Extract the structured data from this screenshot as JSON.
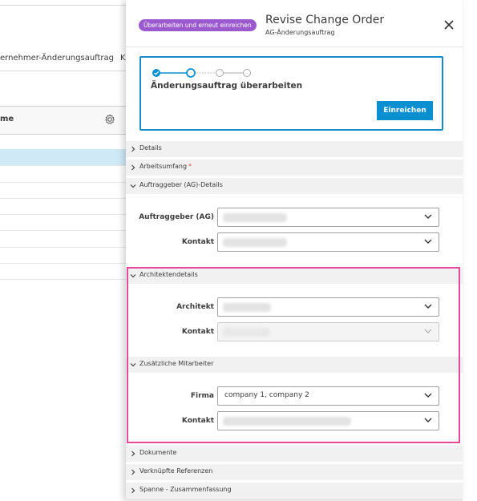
{
  "background": {
    "tab_label": "ernehmer-Änderungsauftrag",
    "tab_label2": "K",
    "column_header": "me",
    "icons": {
      "settings": "gear-icon"
    }
  },
  "panel": {
    "status": "Überarbeiten und erneut einreichen",
    "title": "Revise Change Order",
    "subtitle": "AG-Änderungsauftrag",
    "icons": {
      "close": "close-icon"
    }
  },
  "stepper": {
    "title": "Änderungsauftrag überarbeiten",
    "steps_completed": 1,
    "current_step": 2,
    "total_steps": 4,
    "submit_label": "Einreichen"
  },
  "sections": {
    "details": "Details",
    "scope": "Arbeitsumfang",
    "scope_required": "*",
    "client": "Auftraggeber (AG)-Details",
    "architect": "Architektendetails",
    "additional": "Zusätzliche Mitarbeiter",
    "documents": "Dokumente",
    "refs": "Verknüpfte Referenzen",
    "summary": "Spanne - Zusammenfassung"
  },
  "fields": {
    "client_label": "Auftraggeber (AG)",
    "client_contact_label": "Kontakt",
    "architect_label": "Architekt",
    "architect_contact_label": "Kontakt",
    "company_label": "Firma",
    "company_value": "company 1, company 2",
    "company_contact_label": "Kontakt"
  },
  "colors": {
    "accent": "#0a8fd1",
    "status_pill": "#9b59d0",
    "highlight": "#e6499a",
    "required": "#e0453a",
    "selected_row": "#cfe9f6"
  }
}
